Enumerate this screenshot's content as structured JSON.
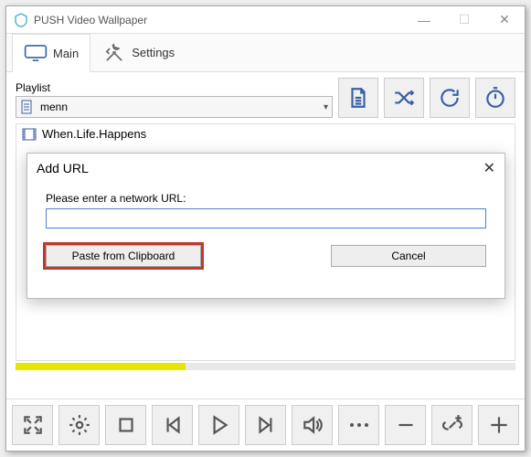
{
  "titlebar": {
    "title": "PUSH Video Wallpaper"
  },
  "tabs": {
    "main": "Main",
    "settings": "Settings"
  },
  "playlist": {
    "label": "Playlist",
    "selected": "menn",
    "items": [
      "When.Life.Happens"
    ]
  },
  "modal": {
    "title": "Add URL",
    "prompt": "Please enter a network URL:",
    "input_value": "",
    "paste_label": "Paste from Clipboard",
    "cancel_label": "Cancel"
  },
  "icons": {
    "doc": "document-icon",
    "shuffle": "shuffle-icon",
    "loop": "loop-icon",
    "timer": "timer-icon",
    "expand": "expand-icon",
    "gear": "gear-icon",
    "stop": "stop-icon",
    "prev": "prev-icon",
    "play": "play-icon",
    "next": "next-icon",
    "volume": "volume-icon",
    "more": "more-icon",
    "minus": "remove-icon",
    "link": "link-icon",
    "plus": "add-icon"
  }
}
